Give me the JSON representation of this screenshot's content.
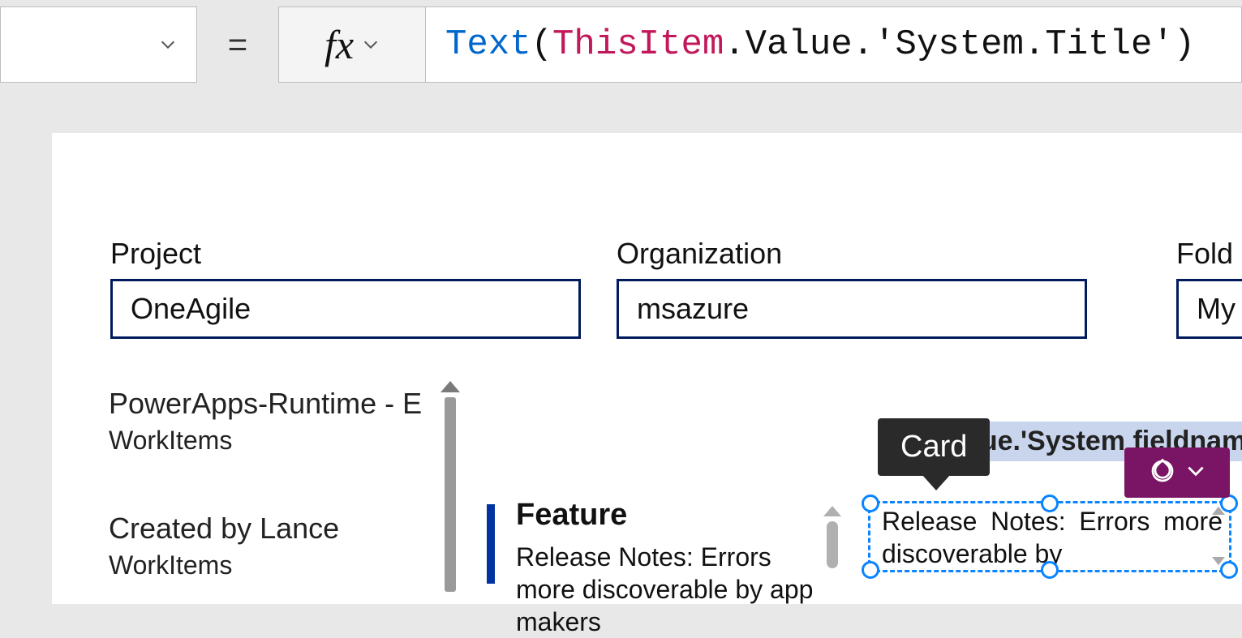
{
  "formula_bar": {
    "equals": "=",
    "fx": "fx",
    "tokens": {
      "fn": "Text",
      "open": "(",
      "this": "ThisItem",
      "rest": ".Value.'System.Title')"
    }
  },
  "fields": {
    "project": {
      "label": "Project",
      "value": "OneAgile"
    },
    "organization": {
      "label": "Organization",
      "value": "msazure"
    },
    "folder": {
      "label": "Fold",
      "value": "My"
    }
  },
  "left_list": [
    {
      "title": "PowerApps-Runtime - E",
      "subtitle": "WorkItems"
    },
    {
      "title": "Created by Lance",
      "subtitle": "WorkItems"
    }
  ],
  "detail": {
    "heading": "Feature",
    "body": "Release Notes: Errors more discoverable by app makers"
  },
  "card": {
    "tooltip": "Card",
    "placeholder": "m.Value.'System fieldname>",
    "text": "Release Notes: Errors more discoverable by"
  }
}
